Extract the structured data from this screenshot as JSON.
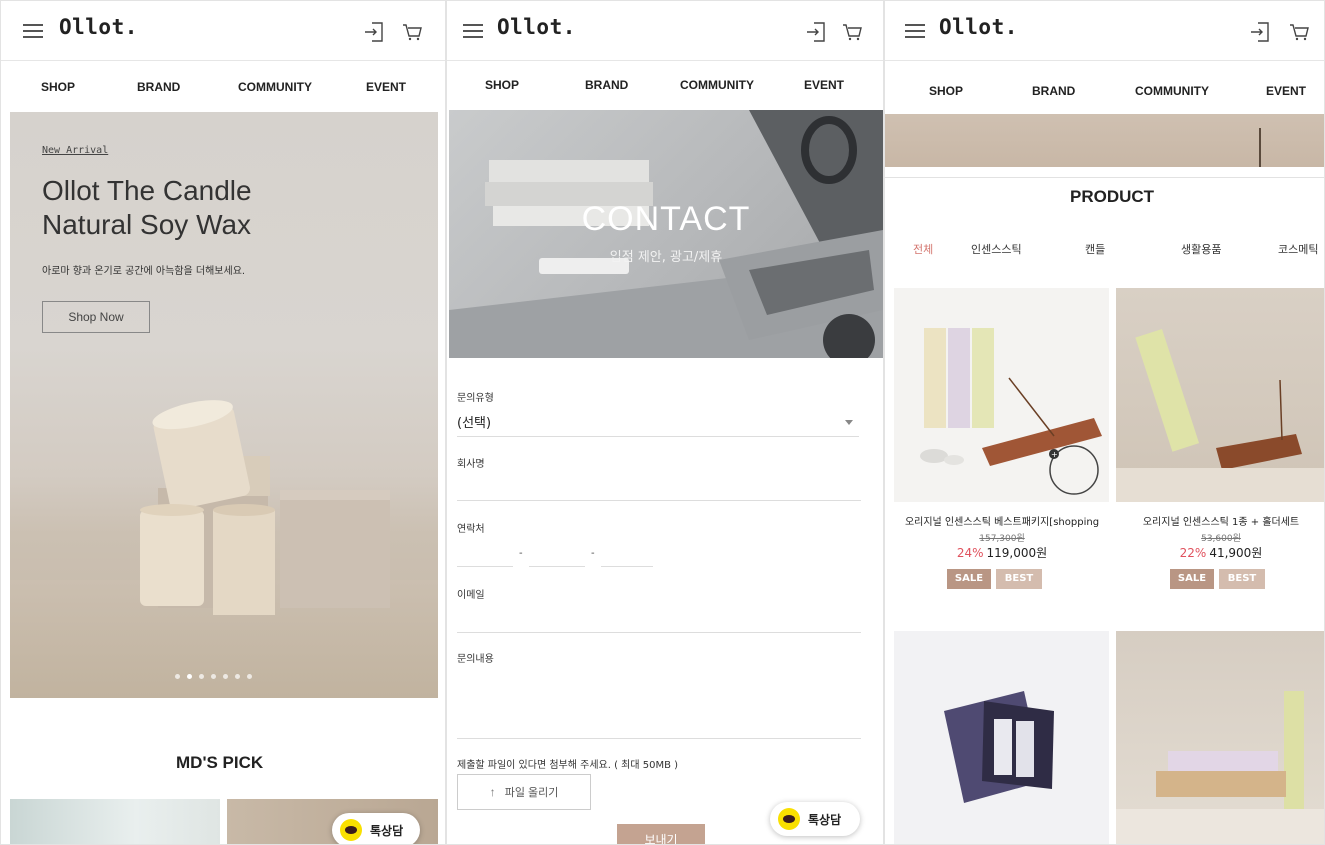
{
  "brand": {
    "logo": "Ollot."
  },
  "nav": [
    "SHOP",
    "BRAND",
    "COMMUNITY",
    "EVENT"
  ],
  "kakao_label": "톡상담",
  "panel1": {
    "hero": {
      "eyebrow": "New Arrival",
      "title_line1": "Ollot The Candle",
      "title_line2": "Natural Soy Wax",
      "subtitle": "아로마 향과 온기로 공간에 아늑함을 더해보세요.",
      "cta": "Shop Now",
      "slides_total": 7,
      "slide_active": 2
    },
    "section_title": "MD'S PICK"
  },
  "panel2": {
    "hero_title": "CONTACT",
    "hero_subtitle": "입점 제안, 광고/제휴",
    "form": {
      "type_label": "문의유형",
      "type_value": "(선택)",
      "company_label": "회사명",
      "phone_label": "연락처",
      "phone_sep": "-",
      "email_label": "이메일",
      "content_label": "문의내용",
      "file_hint": "제출할 파일이 있다면 첨부해 주세요. ( 최대 50MB )",
      "upload_label": "파일 올리기",
      "submit_label": "보내기"
    }
  },
  "panel3": {
    "section_title": "PRODUCT",
    "tabs": [
      "전체",
      "인센스스틱",
      "캔들",
      "생활용품",
      "코스메틱"
    ],
    "products": [
      {
        "name": "오리지널 인센스스틱 베스트패키지[shopping",
        "old_price": "157,300원",
        "discount": "24%",
        "price": "119,000원",
        "badges": [
          "SALE",
          "BEST"
        ]
      },
      {
        "name": "오리지널 인센스스틱 1종 + 홀더세트",
        "old_price": "53,600원",
        "discount": "22%",
        "price": "41,900원",
        "badges": [
          "SALE",
          "BEST"
        ]
      }
    ]
  },
  "colors": {
    "accent": "#c4a391",
    "sale": "#b99684",
    "best": "#d4bcae",
    "discount": "#e0525e",
    "active_tab": "#d4766f"
  }
}
